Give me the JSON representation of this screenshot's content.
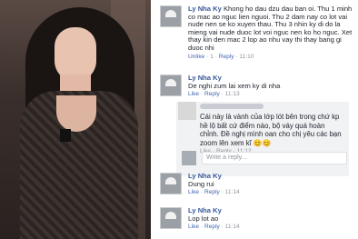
{
  "comments": [
    {
      "name": "Ly Nha Ky",
      "text": "Khong ho dau dzu dau ban oi. Thu 1 minh co mac ao nguc lien nguoi. Thu 2 dam nay co lot vai nude nen se ko xuyen thau. Thu 3 nhin ky di do la mieng vai nude duoc lot voi nguc nen ko ho nguc. Xet thay kin den mac 2 lop ao nhu vay thi thay bang gi duoc nhi",
      "meta_time": "11:10",
      "meta_unlike": "Unlike",
      "meta_count": "1",
      "meta_reply": "Reply"
    },
    {
      "name": "Ly Nha Ky",
      "text": "De nghi zum lai xem ky di nha",
      "meta_time": "11:13",
      "meta_like": "Like",
      "meta_reply": "Reply"
    },
    {
      "name": "Ly Nha Ky",
      "text": "Dung rui",
      "meta_time": "11:14",
      "meta_like": "Like",
      "meta_reply": "Reply"
    },
    {
      "name": "Ly Nha Ky",
      "text": "Lop lot ao",
      "meta_time": "11:14",
      "meta_like": "Like",
      "meta_reply": "Reply"
    }
  ],
  "inline_comment": {
    "text": "Cái này là vành của lớp lót bên trong chứ kp hề lộ bất cứ điểm nào, bộ váy quá hoàn chỉnh. Đề nghị mình oan cho chị yêu các bạn zoom lên xem kĩ 😊😊",
    "meta": "Like · Reply · 11:12"
  },
  "reply_box": {
    "placeholder": "Write a reply..."
  }
}
